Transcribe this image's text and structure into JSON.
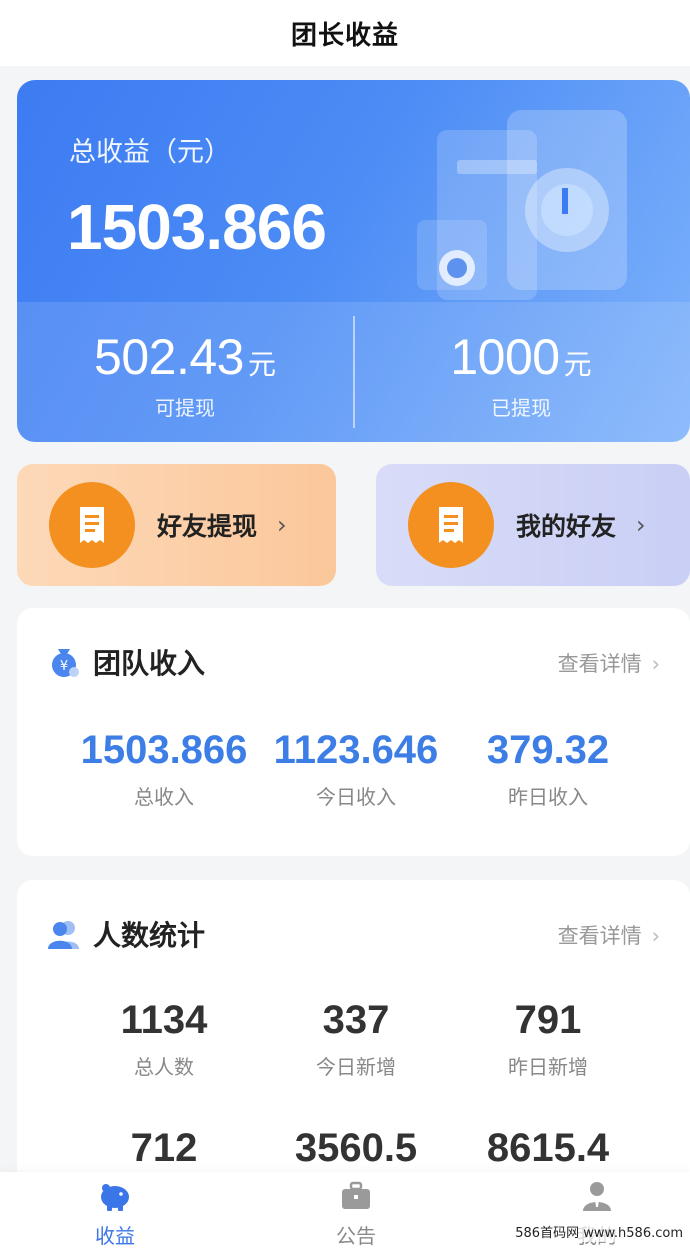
{
  "header": {
    "title": "团长收益"
  },
  "balance": {
    "total_label": "总收益（元）",
    "total_value": "1503.866",
    "withdrawable": {
      "amount": "502.43",
      "unit": "元",
      "label": "可提现"
    },
    "withdrawn": {
      "amount": "1000",
      "unit": "元",
      "label": "已提现"
    }
  },
  "actions": {
    "friend_withdraw": {
      "label": "好友提现",
      "chevron": "›"
    },
    "my_friends": {
      "label": "我的好友",
      "chevron": "›"
    }
  },
  "team_income": {
    "title": "团队收入",
    "link": "查看详情",
    "chevron": "›",
    "stats": [
      {
        "value": "1503.866",
        "label": "总收入"
      },
      {
        "value": "1123.646",
        "label": "今日收入"
      },
      {
        "value": "379.32",
        "label": "昨日收入"
      }
    ]
  },
  "people_stats": {
    "title": "人数统计",
    "link": "查看详情",
    "chevron": "›",
    "row1": [
      {
        "value": "1134",
        "label": "总人数"
      },
      {
        "value": "337",
        "label": "今日新增"
      },
      {
        "value": "791",
        "label": "昨日新增"
      }
    ],
    "row2": [
      {
        "value": "712"
      },
      {
        "value": "3560.5"
      },
      {
        "value": "8615.4"
      }
    ]
  },
  "tabbar": {
    "items": [
      {
        "label": "收益",
        "icon": "piggy-bank-icon",
        "active": true
      },
      {
        "label": "公告",
        "icon": "briefcase-icon",
        "active": false
      },
      {
        "label": "我的",
        "icon": "user-icon",
        "active": false
      }
    ]
  },
  "watermark": "586首码网 www.h586.com",
  "colors": {
    "accent_blue": "#3c7de6",
    "card_blue": "#4c8cf5",
    "orange": "#f3901f"
  }
}
